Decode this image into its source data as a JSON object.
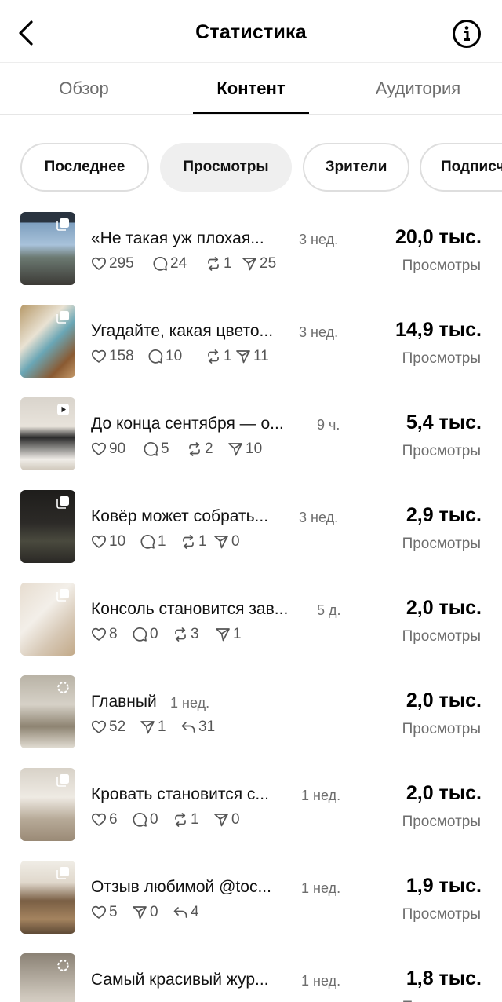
{
  "header": {
    "title": "Статистика",
    "back_icon": "chevron-left-icon",
    "info_icon": "info-icon"
  },
  "tabs": [
    {
      "label": "Обзор",
      "active": false
    },
    {
      "label": "Контент",
      "active": true
    },
    {
      "label": "Аудитория",
      "active": false
    }
  ],
  "chips": [
    {
      "label": "Последнее",
      "active": false
    },
    {
      "label": "Просмотры",
      "active": true
    },
    {
      "label": "Зрители",
      "active": false
    },
    {
      "label": "Подписч",
      "active": false
    }
  ],
  "metric_label": "Просмотры",
  "posts": [
    {
      "title": "«Не такая уж плохая...",
      "age": "3 нед.",
      "value": "20,0 тыс.",
      "label": "Просмотры",
      "badge": "carousel-icon",
      "stats": [
        {
          "icon": "heart-icon",
          "value": "295"
        },
        {
          "icon": "comment-icon",
          "value": "24"
        },
        {
          "icon": "repost-icon",
          "value": "1"
        },
        {
          "icon": "share-icon",
          "value": "25"
        }
      ]
    },
    {
      "title": "Угадайте, какая цвето...",
      "age": "3 нед.",
      "value": "14,9 тыс.",
      "label": "Просмотры",
      "badge": "carousel-icon",
      "stats": [
        {
          "icon": "heart-icon",
          "value": "158"
        },
        {
          "icon": "comment-icon",
          "value": "10"
        },
        {
          "icon": "repost-icon",
          "value": "1"
        },
        {
          "icon": "share-icon",
          "value": "11"
        }
      ]
    },
    {
      "title": "До конца сентября — о...",
      "age": "9 ч.",
      "value": "5,4 тыс.",
      "label": "Просмотры",
      "badge": "reel-icon",
      "stats": [
        {
          "icon": "heart-icon",
          "value": "90"
        },
        {
          "icon": "comment-icon",
          "value": "5"
        },
        {
          "icon": "repost-icon",
          "value": "2"
        },
        {
          "icon": "share-icon",
          "value": "10"
        }
      ]
    },
    {
      "title": "Ковёр может собрать...",
      "age": "3 нед.",
      "value": "2,9 тыс.",
      "label": "Просмотры",
      "badge": "carousel-icon",
      "stats": [
        {
          "icon": "heart-icon",
          "value": "10"
        },
        {
          "icon": "comment-icon",
          "value": "1"
        },
        {
          "icon": "repost-icon",
          "value": "1"
        },
        {
          "icon": "share-icon",
          "value": "0"
        }
      ]
    },
    {
      "title": "Консоль становится зав...",
      "age": "5 д.",
      "value": "2,0 тыс.",
      "label": "Просмотры",
      "badge": "carousel-icon",
      "stats": [
        {
          "icon": "heart-icon",
          "value": "8"
        },
        {
          "icon": "comment-icon",
          "value": "0"
        },
        {
          "icon": "repost-icon",
          "value": "3"
        },
        {
          "icon": "share-icon",
          "value": "1"
        }
      ]
    },
    {
      "title": "Главный",
      "age": "1 нед.",
      "value": "2,0 тыс.",
      "label": "Просмотры",
      "badge": "story-icon",
      "stats": [
        {
          "icon": "heart-icon",
          "value": "52"
        },
        {
          "icon": "share-icon",
          "value": "1"
        },
        {
          "icon": "reply-icon",
          "value": "31"
        }
      ]
    },
    {
      "title": "Кровать становится с...",
      "age": "1 нед.",
      "value": "2,0 тыс.",
      "label": "Просмотры",
      "badge": "carousel-icon",
      "stats": [
        {
          "icon": "heart-icon",
          "value": "6"
        },
        {
          "icon": "comment-icon",
          "value": "0"
        },
        {
          "icon": "repost-icon",
          "value": "1"
        },
        {
          "icon": "share-icon",
          "value": "0"
        }
      ]
    },
    {
      "title": "Отзыв любимой @toc...",
      "age": "1 нед.",
      "value": "1,9 тыс.",
      "label": "Просмотры",
      "badge": "carousel-icon",
      "stats": [
        {
          "icon": "heart-icon",
          "value": "5"
        },
        {
          "icon": "share-icon",
          "value": "0"
        },
        {
          "icon": "reply-icon",
          "value": "4"
        }
      ]
    },
    {
      "title": "Самый красивый жур...",
      "age": "1 нед.",
      "value": "1,8 тыс.",
      "label": "Просмотры",
      "badge": "story-icon",
      "stats": []
    }
  ]
}
